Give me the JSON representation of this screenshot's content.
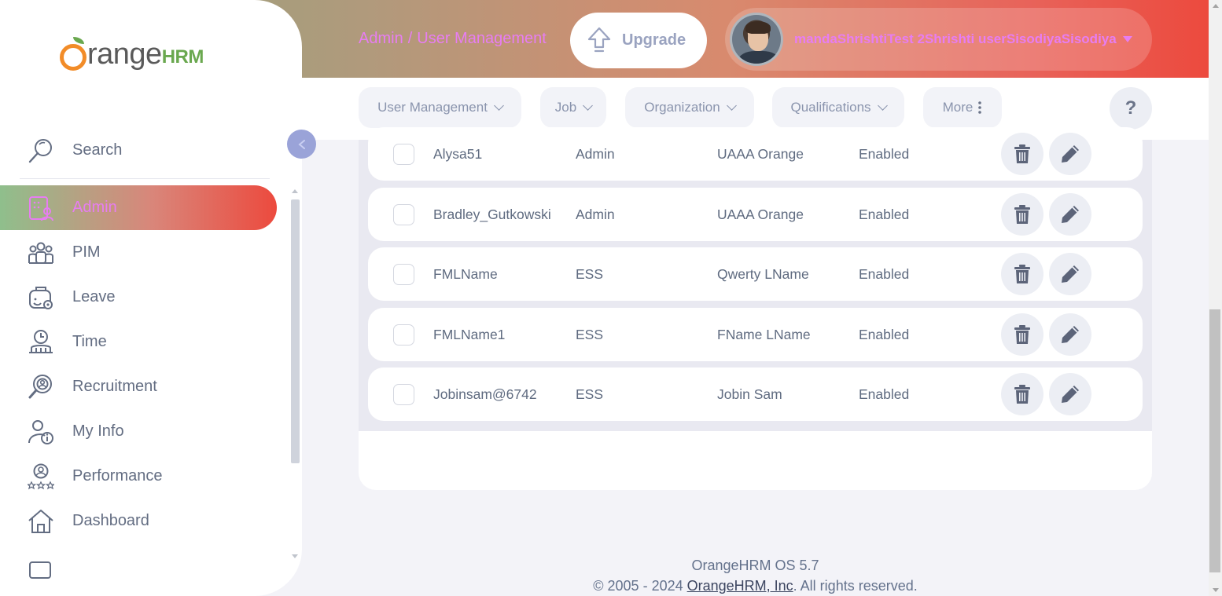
{
  "header": {
    "breadcrumb_module": "Admin",
    "breadcrumb_separator": "/",
    "breadcrumb_page": "User Management",
    "upgrade_label": "Upgrade",
    "user_name": "mandaShrishtiTest 2Shrishti userSisodiyaSisodiya"
  },
  "nav": {
    "items": [
      {
        "label": "User Management",
        "icon": "chevron-down-icon"
      },
      {
        "label": "Job",
        "icon": "chevron-down-icon"
      },
      {
        "label": "Organization",
        "icon": "chevron-down-icon"
      },
      {
        "label": "Qualifications",
        "icon": "chevron-down-icon"
      },
      {
        "label": "More",
        "icon": "kebab-icon"
      }
    ],
    "help_label": "?"
  },
  "sidebar": {
    "logo_text": "range",
    "logo_suffix": "HRM",
    "search_label": "Search",
    "items": [
      {
        "label": "Admin",
        "icon": "admin-icon",
        "active": true
      },
      {
        "label": "PIM",
        "icon": "people-icon"
      },
      {
        "label": "Leave",
        "icon": "leave-icon"
      },
      {
        "label": "Time",
        "icon": "time-icon"
      },
      {
        "label": "Recruitment",
        "icon": "recruitment-icon"
      },
      {
        "label": "My Info",
        "icon": "my-info-icon"
      },
      {
        "label": "Performance",
        "icon": "performance-icon"
      },
      {
        "label": "Dashboard",
        "icon": "home-icon"
      }
    ]
  },
  "table": {
    "rows": [
      {
        "username": "Alysa51",
        "role": "Admin",
        "employee": "UAAA Orange",
        "status": "Enabled"
      },
      {
        "username": "Bradley_Gutkowski",
        "role": "Admin",
        "employee": "UAAA Orange",
        "status": "Enabled"
      },
      {
        "username": "FMLName",
        "role": "ESS",
        "employee": "Qwerty LName",
        "status": "Enabled"
      },
      {
        "username": "FMLName1",
        "role": "ESS",
        "employee": "FName LName",
        "status": "Enabled"
      },
      {
        "username": "Jobinsam@6742",
        "role": "ESS",
        "employee": "Jobin Sam",
        "status": "Enabled"
      }
    ]
  },
  "footer": {
    "version": "OrangeHRM OS 5.7",
    "copyright_prefix": "© 2005 - 2024 ",
    "company_link": "OrangeHRM, Inc",
    "copyright_suffix": ". All rights reserved."
  },
  "colors": {
    "accent_pink": "#e77df2",
    "brand_orange": "#f28c28",
    "brand_green": "#6aa84f",
    "header_gradient_end": "#ec4a3e"
  }
}
